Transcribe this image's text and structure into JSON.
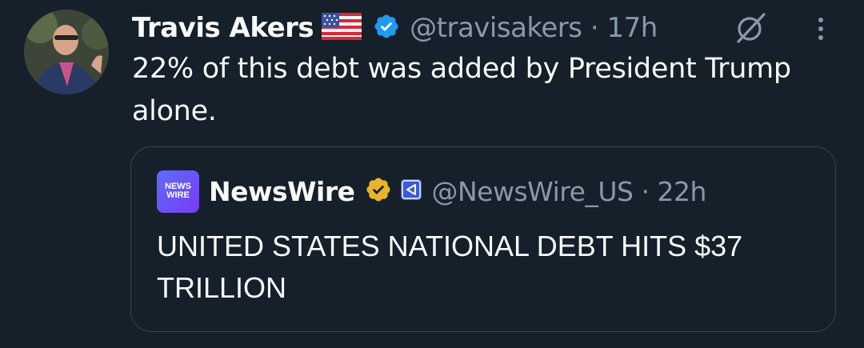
{
  "tweet": {
    "author": {
      "name": "Travis Akers",
      "flag": "us-flag-icon",
      "verified": true,
      "handle": "@travisakers",
      "separator": "·",
      "time": "17h"
    },
    "text": "22% of this debt was added by President Trump alone.",
    "actions": {
      "grok_icon": "grok-icon",
      "more_icon": "more-icon"
    }
  },
  "quoted": {
    "author": {
      "name": "NewsWire",
      "avatar_text_line1": "NEWS",
      "avatar_text_line2": "WIRE",
      "verified_type": "gold",
      "affiliate_icon": "affiliate-badge-icon",
      "handle": "@NewsWire_US",
      "separator": "·",
      "time": "22h"
    },
    "text": "UNITED STATES NATIONAL DEBT HITS $37 TRILLION"
  },
  "colors": {
    "background": "#15202b",
    "primary_text": "#f7f9f9",
    "secondary_text": "#8b98a5",
    "verified_blue": "#1d9bf0",
    "verified_gold": "#e8b529",
    "border": "#38444d"
  }
}
